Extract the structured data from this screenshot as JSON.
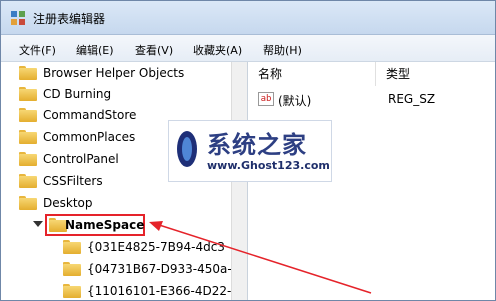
{
  "window": {
    "title": "注册表编辑器"
  },
  "menu": [
    {
      "label": "文件(F)"
    },
    {
      "label": "编辑(E)"
    },
    {
      "label": "查看(V)"
    },
    {
      "label": "收藏夹(A)"
    },
    {
      "label": "帮助(H)"
    }
  ],
  "tree": {
    "items": [
      {
        "label": "Browser Helper Objects"
      },
      {
        "label": "CD Burning"
      },
      {
        "label": "CommandStore"
      },
      {
        "label": "CommonPlaces"
      },
      {
        "label": "ControlPanel"
      },
      {
        "label": "CSSFilters"
      },
      {
        "label": "Desktop"
      },
      {
        "label": "NameSpace",
        "selected": true
      },
      {
        "label": "{031E4825-7B94-4dc3"
      },
      {
        "label": "{04731B67-D933-450a-"
      },
      {
        "label": "{11016101-E366-4D22-"
      }
    ]
  },
  "list": {
    "columns": [
      {
        "label": "名称"
      },
      {
        "label": "类型"
      }
    ],
    "rows": [
      {
        "name": "(默认)",
        "type": "REG_SZ",
        "icon": "ab"
      }
    ]
  },
  "watermark": {
    "title": "系统之家",
    "url": "www.Ghost123.com"
  },
  "colors": {
    "highlight": "#e5232a",
    "folder": "#f0c04c",
    "watermark_text": "#2d3f83"
  },
  "icons": {
    "app": "registry-editor-icon",
    "folder": "folder-icon",
    "expand": "expand-triangle-icon",
    "value": "string-value-icon"
  }
}
